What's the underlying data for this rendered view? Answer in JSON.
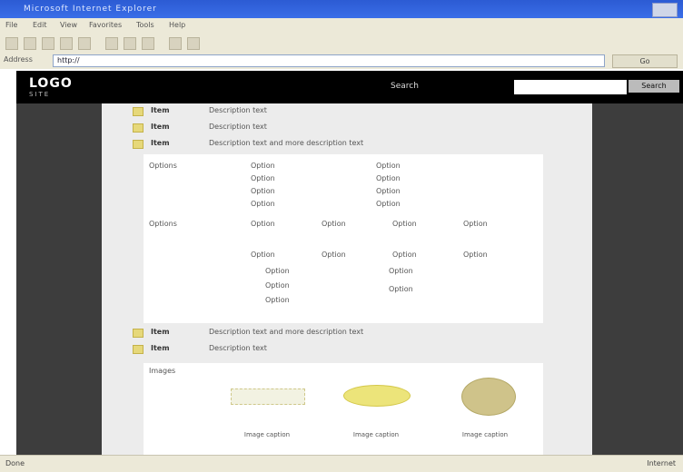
{
  "window": {
    "title": "Microsoft Internet Explorer"
  },
  "menu": [
    "File",
    "Edit",
    "View",
    "Favorites",
    "Tools",
    "Help"
  ],
  "address": {
    "label": "Address",
    "url": "http://",
    "go_label": "Go"
  },
  "site": {
    "logo": "LOGO",
    "tagline": "SITE",
    "search_label": "Search",
    "search_placeholder": "",
    "search_button": "Search"
  },
  "content": {
    "rows": [
      {
        "key": "Item",
        "value": "Description text"
      },
      {
        "key": "Item",
        "value": "Description text"
      },
      {
        "key": "Item",
        "value": "Description text and more description text"
      }
    ],
    "panel1": {
      "label": "Options",
      "items": [
        "Option",
        "Option",
        "Option",
        "Option",
        "Option",
        "Option",
        "Option",
        "Option"
      ]
    },
    "panel2": {
      "label": "Options",
      "items": [
        "Option",
        "Option",
        "Option",
        "Option",
        "Option",
        "Option",
        "Option",
        "Option",
        "Option",
        "Option",
        "Option",
        "Option",
        "Option"
      ]
    },
    "rows2": [
      {
        "key": "Item",
        "value": "Description text and more description text"
      },
      {
        "key": "Item",
        "value": "Description text"
      }
    ],
    "gallery": {
      "label": "Images",
      "captions": [
        "Image caption",
        "Image caption",
        "Image caption"
      ]
    }
  },
  "status": {
    "text": "Done",
    "zone": "Internet"
  }
}
